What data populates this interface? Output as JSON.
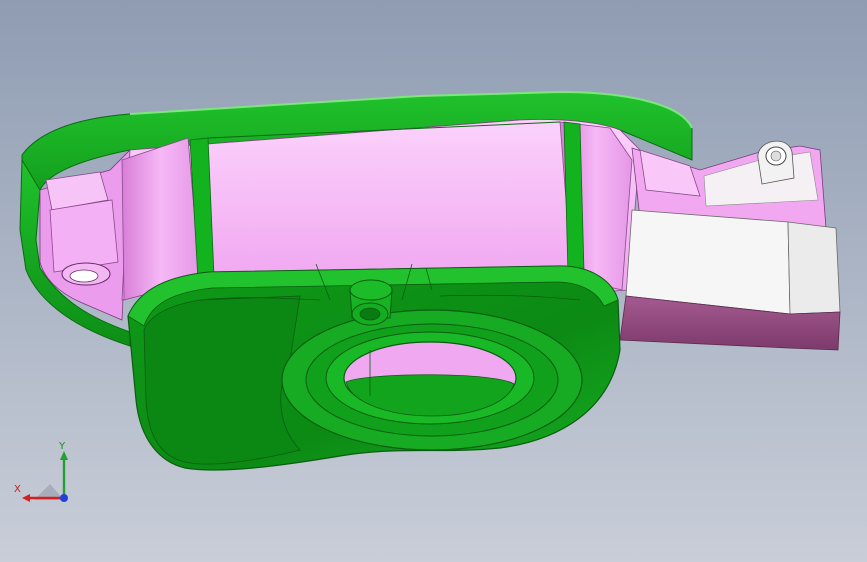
{
  "viewport": {
    "background_top": "#8f9cb2",
    "background_bottom": "#c9ced8"
  },
  "model": {
    "colors": {
      "green": "#13b21f",
      "green_dark": "#0a7f12",
      "pink": "#f2a6f2",
      "pink_light": "#fbd2fb",
      "mauve": "#9c4c86",
      "white": "#f4f4f4"
    }
  },
  "triad": {
    "x_label": "X",
    "y_label": "Y",
    "x_color": "#d42020",
    "y_color": "#22a032",
    "z_color": "#2440d8"
  }
}
